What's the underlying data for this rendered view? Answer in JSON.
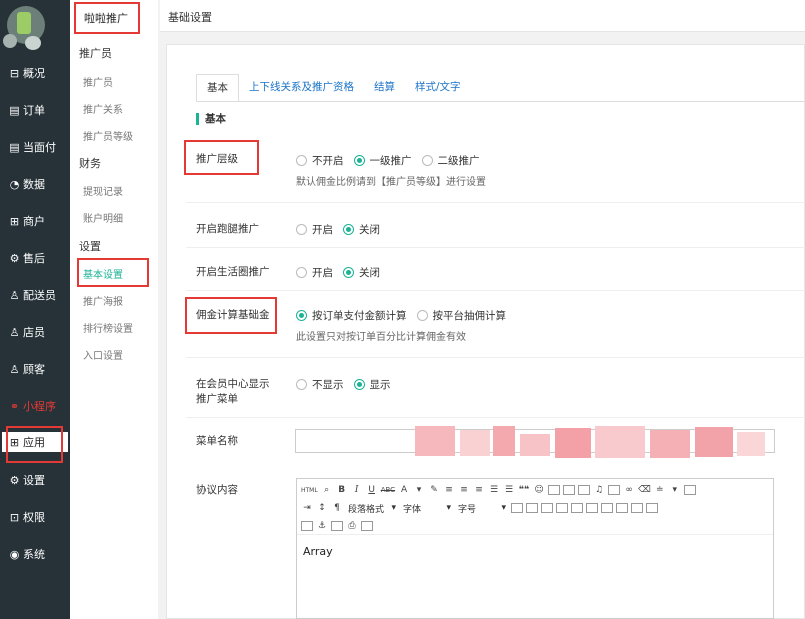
{
  "sidebar": {
    "items": [
      {
        "label": "概况",
        "icon": "overview-icon",
        "glyph": "⊟"
      },
      {
        "label": "订单",
        "icon": "order-icon",
        "glyph": "▤"
      },
      {
        "label": "当面付",
        "icon": "face-pay-icon",
        "glyph": "▤"
      },
      {
        "label": "数据",
        "icon": "data-icon",
        "glyph": "◔"
      },
      {
        "label": "商户",
        "icon": "merchant-icon",
        "glyph": "⊞"
      },
      {
        "label": "售后",
        "icon": "after-sales-icon",
        "glyph": "⚙"
      },
      {
        "label": "配送员",
        "icon": "courier-icon",
        "glyph": "♙"
      },
      {
        "label": "店员",
        "icon": "clerk-icon",
        "glyph": "♙"
      },
      {
        "label": "顾客",
        "icon": "customer-icon",
        "glyph": "♙"
      },
      {
        "label": "小程序",
        "icon": "mini-program-icon",
        "glyph": "⚭"
      },
      {
        "label": "应用",
        "icon": "apps-icon",
        "glyph": "⊞"
      },
      {
        "label": "设置",
        "icon": "settings-icon",
        "glyph": "⚙"
      },
      {
        "label": "权限",
        "icon": "lock-icon",
        "glyph": "⊡"
      },
      {
        "label": "系统",
        "icon": "system-icon",
        "glyph": "◉"
      }
    ]
  },
  "submenu": {
    "title": "啦啦推广",
    "groups": [
      {
        "label": "推广员",
        "items": [
          "推广员",
          "推广关系",
          "推广员等级"
        ]
      },
      {
        "label": "财务",
        "items": [
          "提现记录",
          "账户明细"
        ]
      },
      {
        "label": "设置",
        "items": [
          "基本设置",
          "推广海报",
          "排行榜设置",
          "入口设置"
        ]
      }
    ]
  },
  "header": {
    "breadcrumb": "基础设置"
  },
  "tabs": [
    "基本",
    "上下线关系及推广资格",
    "结算",
    "样式/文字"
  ],
  "section_title": "基本",
  "form": {
    "level": {
      "label": "推广层级",
      "options": [
        "不开启",
        "一级推广",
        "二级推广"
      ],
      "selected": 1,
      "help": "默认佣金比例请到【推广员等级】进行设置"
    },
    "errand": {
      "label": "开启跑腿推广",
      "options": [
        "开启",
        "关闭"
      ],
      "selected": 1
    },
    "life_circle": {
      "label": "开启生活圈推广",
      "options": [
        "开启",
        "关闭"
      ],
      "selected": 1
    },
    "commission_base": {
      "label": "佣金计算基础金",
      "options": [
        "按订单支付金额计算",
        "按平台抽佣计算"
      ],
      "selected": 0,
      "help": "此设置只对按订单百分比计算佣金有效"
    },
    "member_menu": {
      "label_line1": "在会员中心显示",
      "label_line2": "推广菜单",
      "options": [
        "不显示",
        "显示"
      ],
      "selected": 1
    },
    "menu_name": {
      "label": "菜单名称",
      "value": ""
    },
    "agreement": {
      "label": "协议内容",
      "content": "Array"
    }
  },
  "editor": {
    "html_label": "HTML",
    "bold": "B",
    "italic": "I",
    "underline": "U",
    "strike": "ABC",
    "font_color": "A",
    "quote": "❝❝",
    "paragraph_format": "段落格式",
    "font_family": "字体",
    "font_size": "字号"
  },
  "colors": {
    "accent": "#1ab394",
    "sidebar_bg": "#263238",
    "link": "#1a73c8",
    "highlight": "#e53935"
  }
}
